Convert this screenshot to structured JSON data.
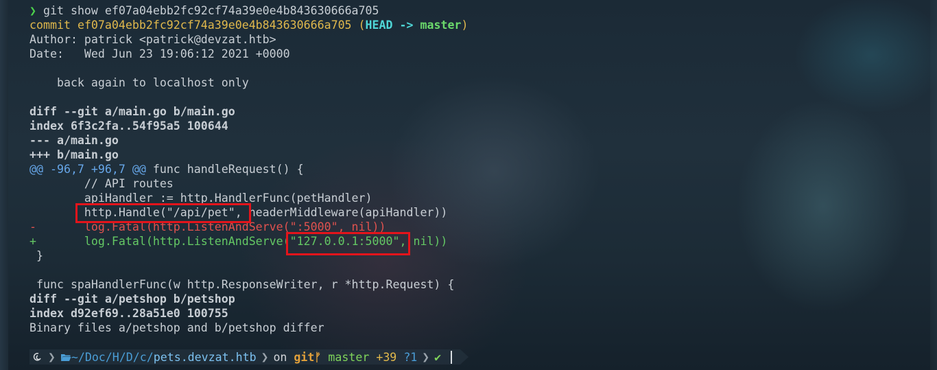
{
  "terminal": {
    "lines": [
      {
        "kind": "prompt",
        "arrow": "❯",
        "cmd": " git show ef07a04ebb2fc92cf74a39e0e4b843630666a705"
      },
      {
        "kind": "commit",
        "label": "commit ",
        "hash": "ef07a04ebb2fc92cf74a39e0e4b843630666a705",
        "open": " (",
        "head": "HEAD -> ",
        "branch": "master",
        "close": ")"
      },
      {
        "kind": "plain",
        "text": "Author: patrick <patrick@devzat.htb>"
      },
      {
        "kind": "plain",
        "text": "Date:   Wed Jun 23 19:06:12 2021 +0000"
      },
      {
        "kind": "plain",
        "text": ""
      },
      {
        "kind": "plain",
        "text": "    back again to localhost only"
      },
      {
        "kind": "plain",
        "text": ""
      },
      {
        "kind": "bold",
        "text": "diff --git a/main.go b/main.go"
      },
      {
        "kind": "bold",
        "text": "index 6f3c2fa..54f95a5 100644"
      },
      {
        "kind": "bold",
        "text": "--- a/main.go"
      },
      {
        "kind": "bold",
        "text": "+++ b/main.go"
      },
      {
        "kind": "hunk",
        "marker": "@@ -96,7 +96,7 @@",
        "rest": " func handleRequest() {"
      },
      {
        "kind": "plain",
        "text": "        // API routes"
      },
      {
        "kind": "plain",
        "text": "        apiHandler := http.HandlerFunc(petHandler)"
      },
      {
        "kind": "plain",
        "text": "        http.Handle(\"/api/pet\", headerMiddleware(apiHandler))"
      },
      {
        "kind": "removed",
        "text": "-       log.Fatal(http.ListenAndServe(\":5000\", nil))"
      },
      {
        "kind": "added",
        "text": "+       log.Fatal(http.ListenAndServe(\"127.0.0.1:5000\", nil))"
      },
      {
        "kind": "plain",
        "text": " }"
      },
      {
        "kind": "plain",
        "text": ""
      },
      {
        "kind": "plain",
        "text": " func spaHandlerFunc(w http.ResponseWriter, r *http.Request) {"
      },
      {
        "kind": "bold",
        "text": "diff --git a/petshop b/petshop"
      },
      {
        "kind": "bold",
        "text": "index d92ef69..28a51e0 100755"
      },
      {
        "kind": "plain",
        "text": "Binary files a/petshop and b/petshop differ"
      }
    ]
  },
  "prompt_bar": {
    "os_icon": "@",
    "folder_icon": "📂",
    "path_prefix": "~/Doc/H/D/c/",
    "path_last": "pets.devzat.htb",
    "on": "on",
    "git_icon": "git",
    "branch_icon": "ᚠ",
    "branch": "master",
    "staged": "+39",
    "untracked": "?1",
    "status_ok": "✔"
  },
  "colors": {
    "highlight_box": "#e4141b",
    "prompt_arrow": "#4cd24c",
    "commit_hash": "#e0b84c",
    "head": "#4fd6d6",
    "branch": "#6bd96b",
    "removed": "#e0524f",
    "added": "#64c864",
    "hunk": "#66a6e8"
  }
}
